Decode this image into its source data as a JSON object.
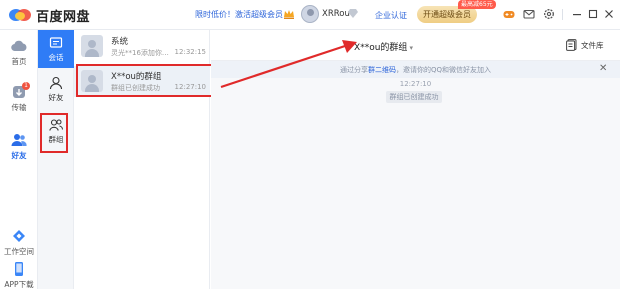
{
  "app": {
    "name": "百度网盘"
  },
  "titlebar": {
    "promo_text": "限时低价！激活超级会员",
    "username": "XRRou",
    "enterprise_label": "企业认证",
    "vip_button_label": "开通超级会员",
    "vip_badge": "最高减65元",
    "icons": [
      "crown-icon",
      "diamond-icon",
      "game-icon",
      "mail-icon",
      "settings-icon",
      "minimize-icon",
      "maximize-icon",
      "close-icon"
    ]
  },
  "leftnav": {
    "items": [
      {
        "label": "首页",
        "icon": "cloud-icon"
      },
      {
        "label": "传输",
        "icon": "transfer-icon",
        "badge": "1"
      },
      {
        "label": "好友",
        "icon": "friends-icon",
        "active": true
      },
      {
        "label": "工作空间",
        "icon": "workspace-icon"
      },
      {
        "label": "APP下载",
        "icon": "phone-icon"
      }
    ]
  },
  "chatnav": {
    "items": [
      {
        "label": "会话",
        "icon": "chat-icon",
        "selected": true
      },
      {
        "label": "好友",
        "icon": "person-icon"
      },
      {
        "label": "群组",
        "icon": "group-icon"
      }
    ]
  },
  "conversations": [
    {
      "title": "系统",
      "preview": "灵光**16添加你…",
      "time": "12:32:15"
    },
    {
      "title": "X**ou的群组",
      "preview": "群组已创建成功",
      "time": "12:27:10",
      "active": true
    }
  ],
  "chat": {
    "title": "X**ou的群组",
    "files_label": "文件库",
    "notice_prefix": "通过分享",
    "notice_link": "群二维码",
    "notice_suffix": "，邀请你的QQ和微信好友加入",
    "message_time": "12:27:10",
    "system_message": "群组已创建成功"
  },
  "colors": {
    "accent": "#2f7cf6",
    "annotation_red": "#e02a2a",
    "vip_gold": "#efcd83"
  }
}
